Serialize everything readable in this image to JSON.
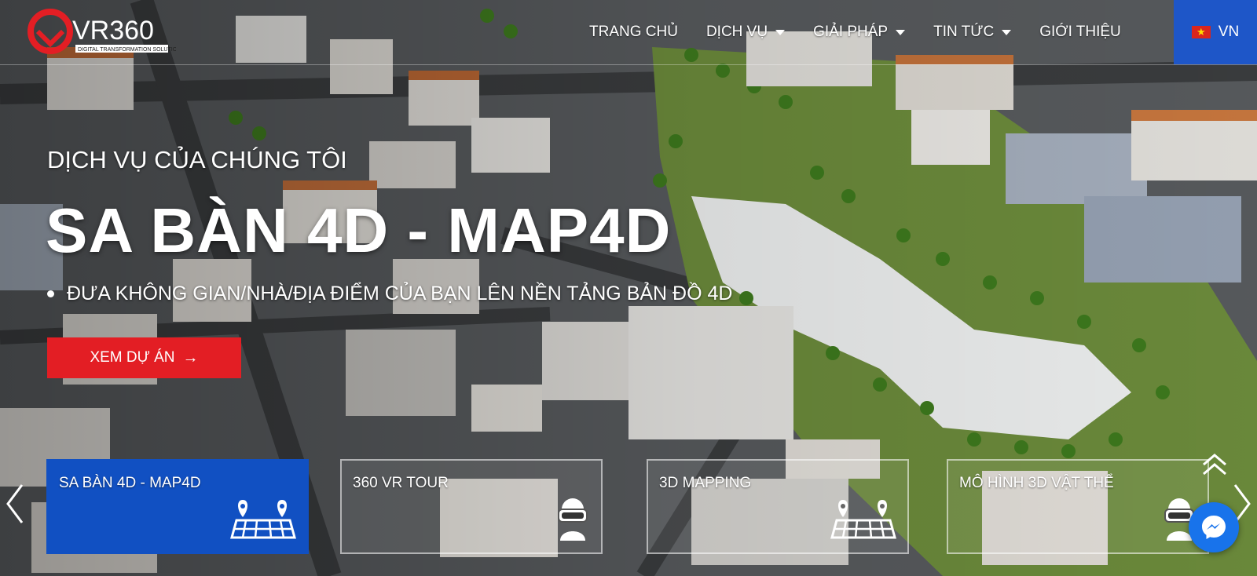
{
  "brand": {
    "logo_text": "VR360",
    "tagline": "DIGITAL TRANSFORMATION SOLUTIONS",
    "accent": "#e31e24"
  },
  "nav": {
    "items": [
      {
        "label": "TRANG CHỦ",
        "dropdown": false,
        "active": true
      },
      {
        "label": "DỊCH VỤ",
        "dropdown": true
      },
      {
        "label": "GIẢI PHÁP",
        "dropdown": true
      },
      {
        "label": "TIN TỨC",
        "dropdown": true
      },
      {
        "label": "GIỚI THIỆU",
        "dropdown": false
      }
    ],
    "lang": {
      "label": "VN",
      "flag_icon": "vietnam-flag-icon"
    }
  },
  "hero": {
    "kicker": "DỊCH VỤ CỦA CHÚNG TÔI",
    "title": "SA BÀN 4D - MAP4D",
    "bullet": "ĐƯA KHÔNG GIAN/NHÀ/ĐỊA ĐIỂM CỦA BẠN LÊN NỀN TẢNG BẢN ĐỒ 4D",
    "cta_label": "XEM DỰ ÁN",
    "cta_icon": "arrow-right-icon",
    "cta_color": "#e31e24"
  },
  "cards": [
    {
      "label": "SA BÀN 4D - MAP4D",
      "icon": "map-pins-icon",
      "active": true
    },
    {
      "label": "360 VR TOUR",
      "icon": "vr-headset-icon",
      "active": false
    },
    {
      "label": "3D MAPPING",
      "icon": "map-pins-icon",
      "active": false
    },
    {
      "label": "MÔ HÌNH 3D VẬT THỂ",
      "icon": "vr-headset-icon",
      "active": false
    }
  ],
  "colors": {
    "active_card": "#1150c2",
    "lang_bg": "#1e56c8",
    "messenger": "#1873eb"
  }
}
